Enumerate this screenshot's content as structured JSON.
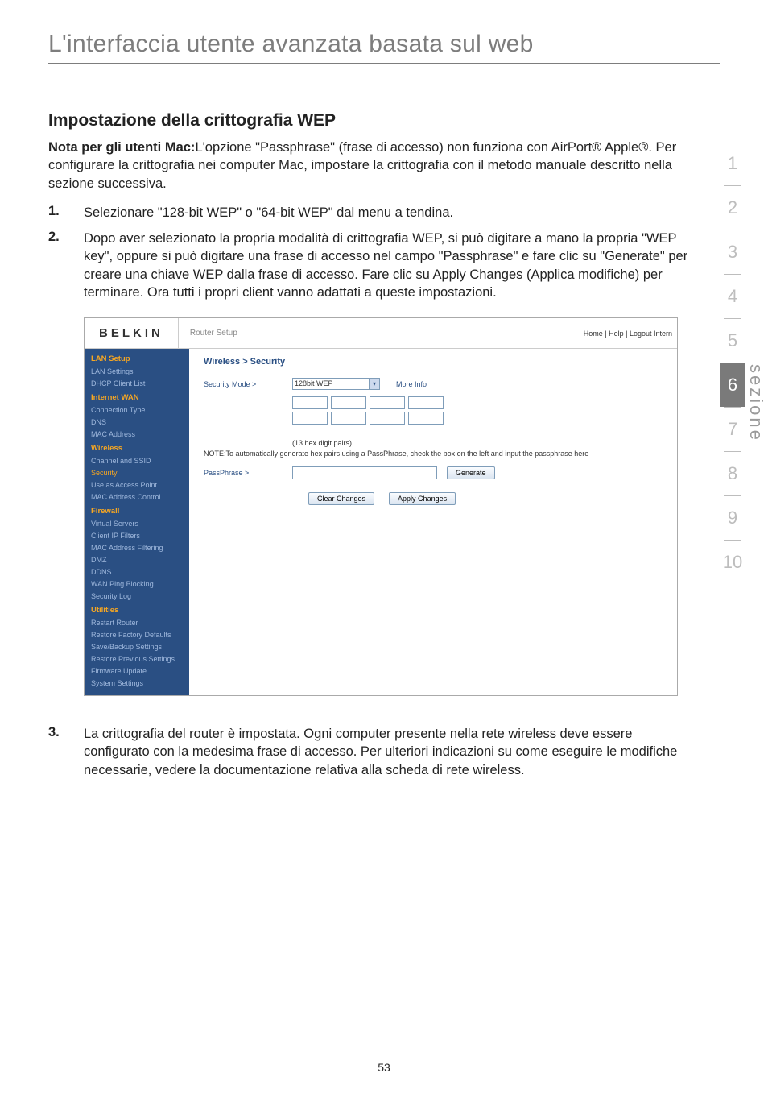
{
  "header": {
    "title": "L'interfaccia utente avanzata basata sul web"
  },
  "section": {
    "heading": "Impostazione della crittografia WEP",
    "intro_bold": "Nota per gli utenti Mac:",
    "intro_rest": "L'opzione \"Passphrase\" (frase di accesso) non funziona con AirPort® Apple®. Per configurare la crittografia nei computer Mac, impostare la crittografia con il metodo manuale descritto nella sezione successiva.",
    "steps": [
      {
        "num": "1.",
        "text": "Selezionare \"128-bit WEP\" o \"64-bit WEP\" dal menu a tendina."
      },
      {
        "num": "2.",
        "text": "Dopo aver selezionato la propria modalità di crittografia WEP, si può digitare a mano la propria \"WEP key\", oppure si può digitare una frase di accesso nel campo \"Passphrase\" e fare clic su \"Generate\" per creare una chiave WEP dalla frase di accesso. Fare clic su Apply Changes (Applica modifiche) per terminare. Ora tutti i propri client vanno adattati a queste impostazioni."
      },
      {
        "num": "3.",
        "text": "La crittografia del router è impostata. Ogni computer presente nella rete wireless deve essere configurato con la medesima frase di accesso. Per ulteriori indicazioni su come eseguire le modifiche necessarie, vedere la documentazione relativa alla scheda di rete wireless."
      }
    ]
  },
  "router": {
    "logo": "BELKIN",
    "header_text": "Router Setup",
    "header_links": "Home | Help | Logout   Intern",
    "sidebar": [
      {
        "type": "head",
        "label": "LAN Setup"
      },
      {
        "type": "item",
        "label": "LAN Settings"
      },
      {
        "type": "item",
        "label": "DHCP Client List"
      },
      {
        "type": "head",
        "label": "Internet WAN"
      },
      {
        "type": "item",
        "label": "Connection Type"
      },
      {
        "type": "item",
        "label": "DNS"
      },
      {
        "type": "item",
        "label": "MAC Address"
      },
      {
        "type": "head",
        "label": "Wireless"
      },
      {
        "type": "item",
        "label": "Channel and SSID"
      },
      {
        "type": "item",
        "label": "Security",
        "sel": true
      },
      {
        "type": "item",
        "label": "Use as Access Point"
      },
      {
        "type": "item",
        "label": "MAC Address Control"
      },
      {
        "type": "head",
        "label": "Firewall"
      },
      {
        "type": "item",
        "label": "Virtual Servers"
      },
      {
        "type": "item",
        "label": "Client IP Filters"
      },
      {
        "type": "item",
        "label": "MAC Address Filtering"
      },
      {
        "type": "item",
        "label": "DMZ"
      },
      {
        "type": "item",
        "label": "DDNS"
      },
      {
        "type": "item",
        "label": "WAN Ping Blocking"
      },
      {
        "type": "item",
        "label": "Security Log"
      },
      {
        "type": "head",
        "label": "Utilities"
      },
      {
        "type": "item",
        "label": "Restart Router"
      },
      {
        "type": "item",
        "label": "Restore Factory Defaults"
      },
      {
        "type": "item",
        "label": "Save/Backup Settings"
      },
      {
        "type": "item",
        "label": "Restore Previous Settings"
      },
      {
        "type": "item",
        "label": "Firmware Update"
      },
      {
        "type": "item",
        "label": "System Settings"
      }
    ],
    "main": {
      "title": "Wireless > Security",
      "security_mode_label": "Security Mode >",
      "security_mode_value": "128bit WEP",
      "more_info": "More Info",
      "hex_note": "(13 hex digit pairs)",
      "note_line": "NOTE:To automatically generate hex pairs using a PassPhrase, check the box on the left and input the passphrase here",
      "passphrase_label": "PassPhrase >",
      "generate_btn": "Generate",
      "clear_btn": "Clear Changes",
      "apply_btn": "Apply Changes"
    }
  },
  "side_tabs": [
    "1",
    "2",
    "3",
    "4",
    "5",
    "6",
    "7",
    "8",
    "9",
    "10"
  ],
  "side_active_index": 5,
  "side_label": "sezione",
  "page_number": "53"
}
